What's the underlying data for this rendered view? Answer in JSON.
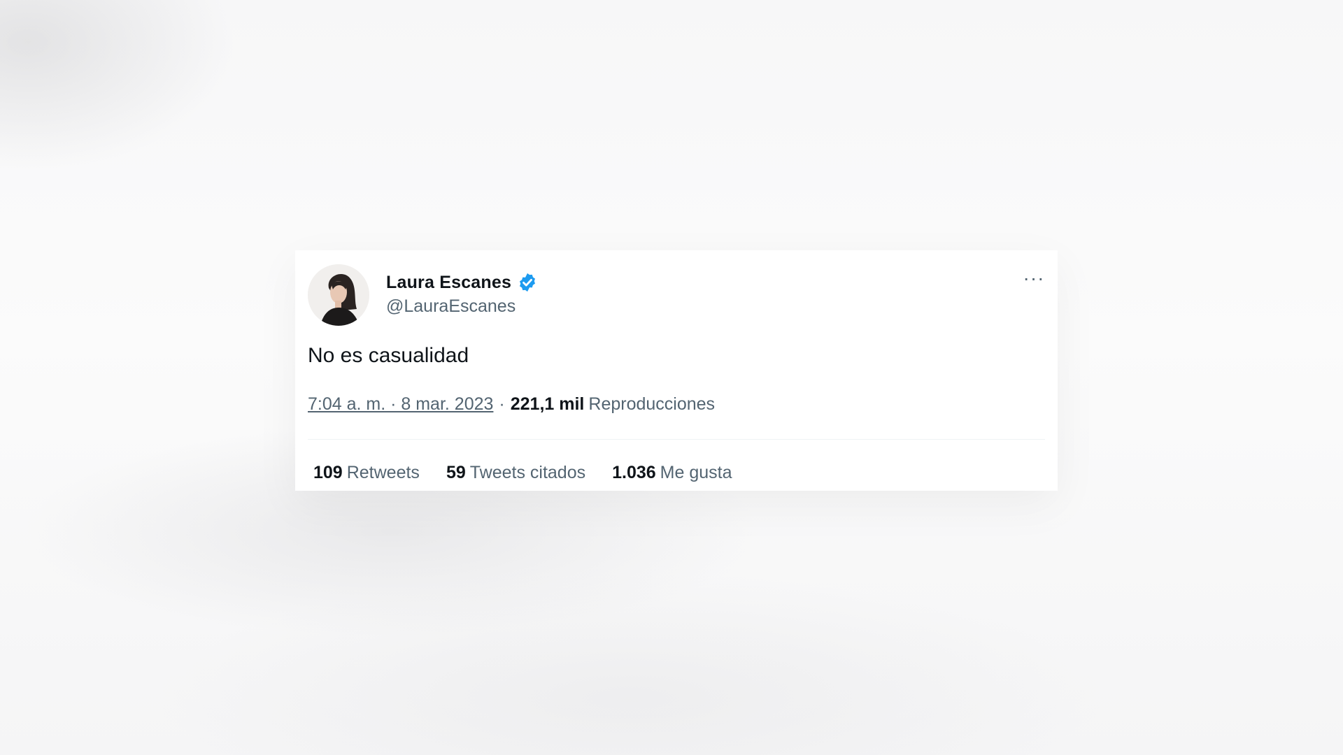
{
  "tweet": {
    "author": {
      "display_name": "Laura Escanes",
      "handle": "@LauraEscanes",
      "verified": true,
      "verified_color": "#1d9bf0"
    },
    "more_icon": "···",
    "text": "No es casualidad",
    "timestamp": "7:04 a. m. · 8 mar. 2023",
    "separator": "·",
    "views": {
      "count": "221,1 mil",
      "label": "Reproducciones"
    },
    "stats": [
      {
        "count": "109",
        "label": "Retweets"
      },
      {
        "count": "59",
        "label": "Tweets citados"
      },
      {
        "count": "1.036",
        "label": "Me gusta"
      }
    ]
  }
}
